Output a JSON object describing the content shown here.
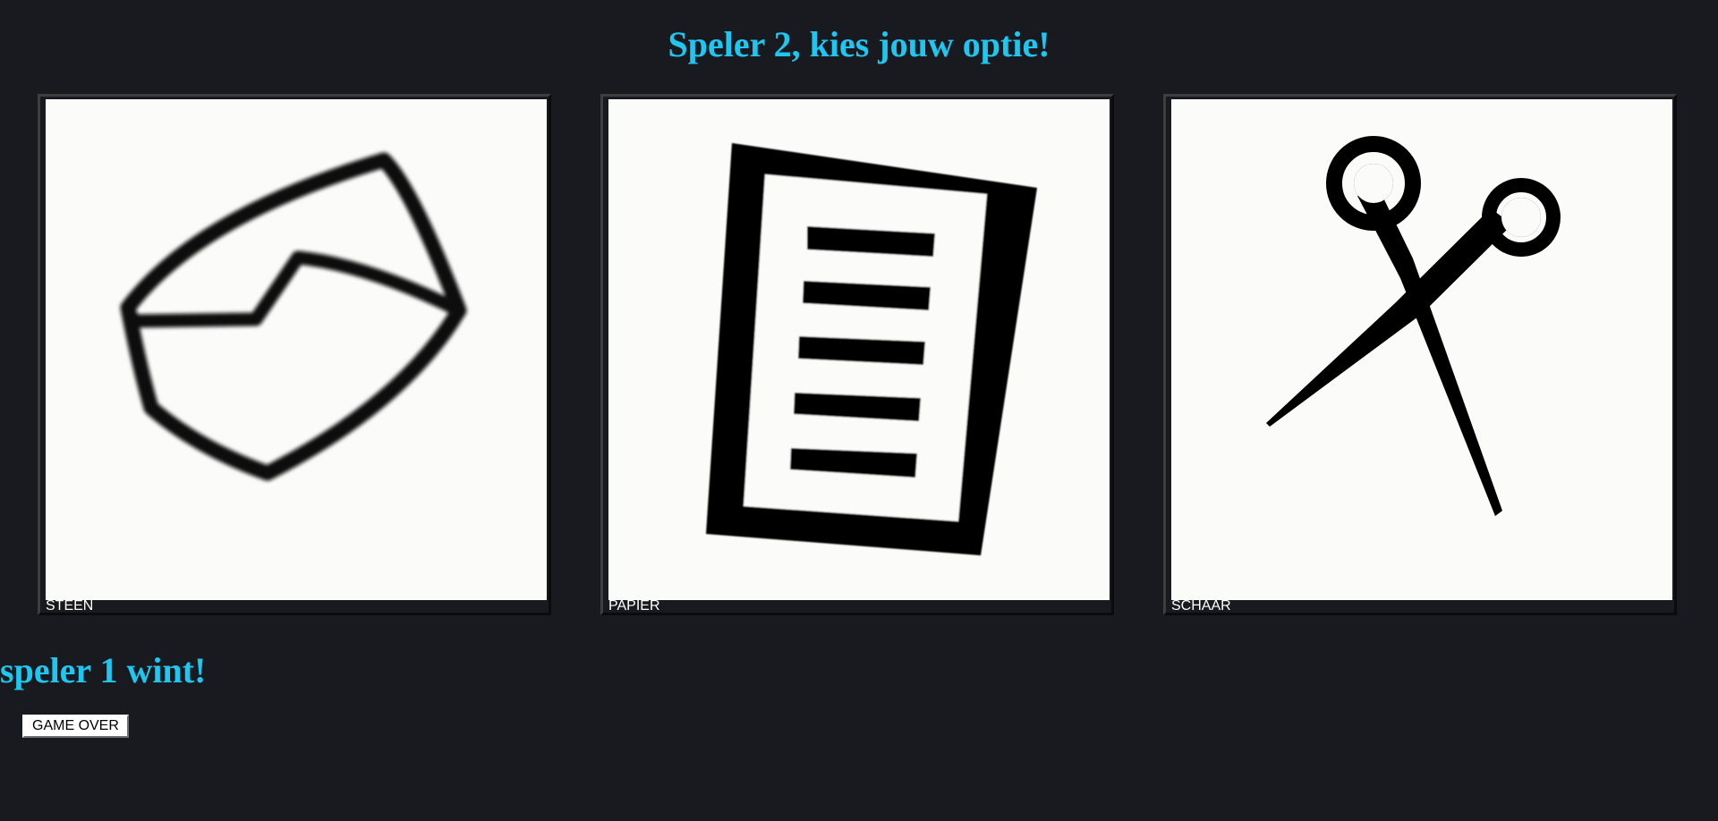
{
  "prompt": "Speler 2, kies jouw optie!",
  "options": [
    {
      "id": "steen",
      "label": "STEEN",
      "icon": "rock-icon"
    },
    {
      "id": "papier",
      "label": "PAPIER",
      "icon": "paper-icon"
    },
    {
      "id": "schaar",
      "label": "SCHAAR",
      "icon": "scissors-icon"
    }
  ],
  "result": "speler 1 wint!",
  "button": {
    "label": "GAME OVER"
  },
  "colors": {
    "background": "#191a1f",
    "heading": "#1ec6f0",
    "card_image_bg": "#fbfbfa",
    "label_text": "#ffffff"
  }
}
